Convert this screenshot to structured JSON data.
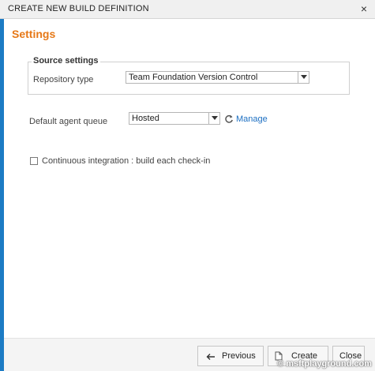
{
  "dialog": {
    "title": "CREATE NEW BUILD DEFINITION",
    "close_glyph": "×"
  },
  "settings": {
    "heading": "Settings",
    "source_settings": {
      "legend": "Source settings",
      "repository_type_label": "Repository type",
      "repository_type_value": "Team Foundation Version Control"
    },
    "default_agent_queue_label": "Default agent queue",
    "default_agent_queue_value": "Hosted",
    "manage_link": "Manage",
    "continuous_integration_label": "Continuous integration : build each check-in",
    "continuous_integration_checked": false
  },
  "footer": {
    "previous_label": "Previous",
    "create_label": "Create",
    "close_label": "Close"
  },
  "watermark": "© msftplayground.com",
  "icons": {
    "refresh": "refresh-icon",
    "dropdown": "chevron-down-icon",
    "previous": "arrow-left-icon",
    "create": "document-icon"
  },
  "colors": {
    "accent": "#1c7bc4",
    "heading": "#e67817",
    "link": "#1c6fc2"
  }
}
